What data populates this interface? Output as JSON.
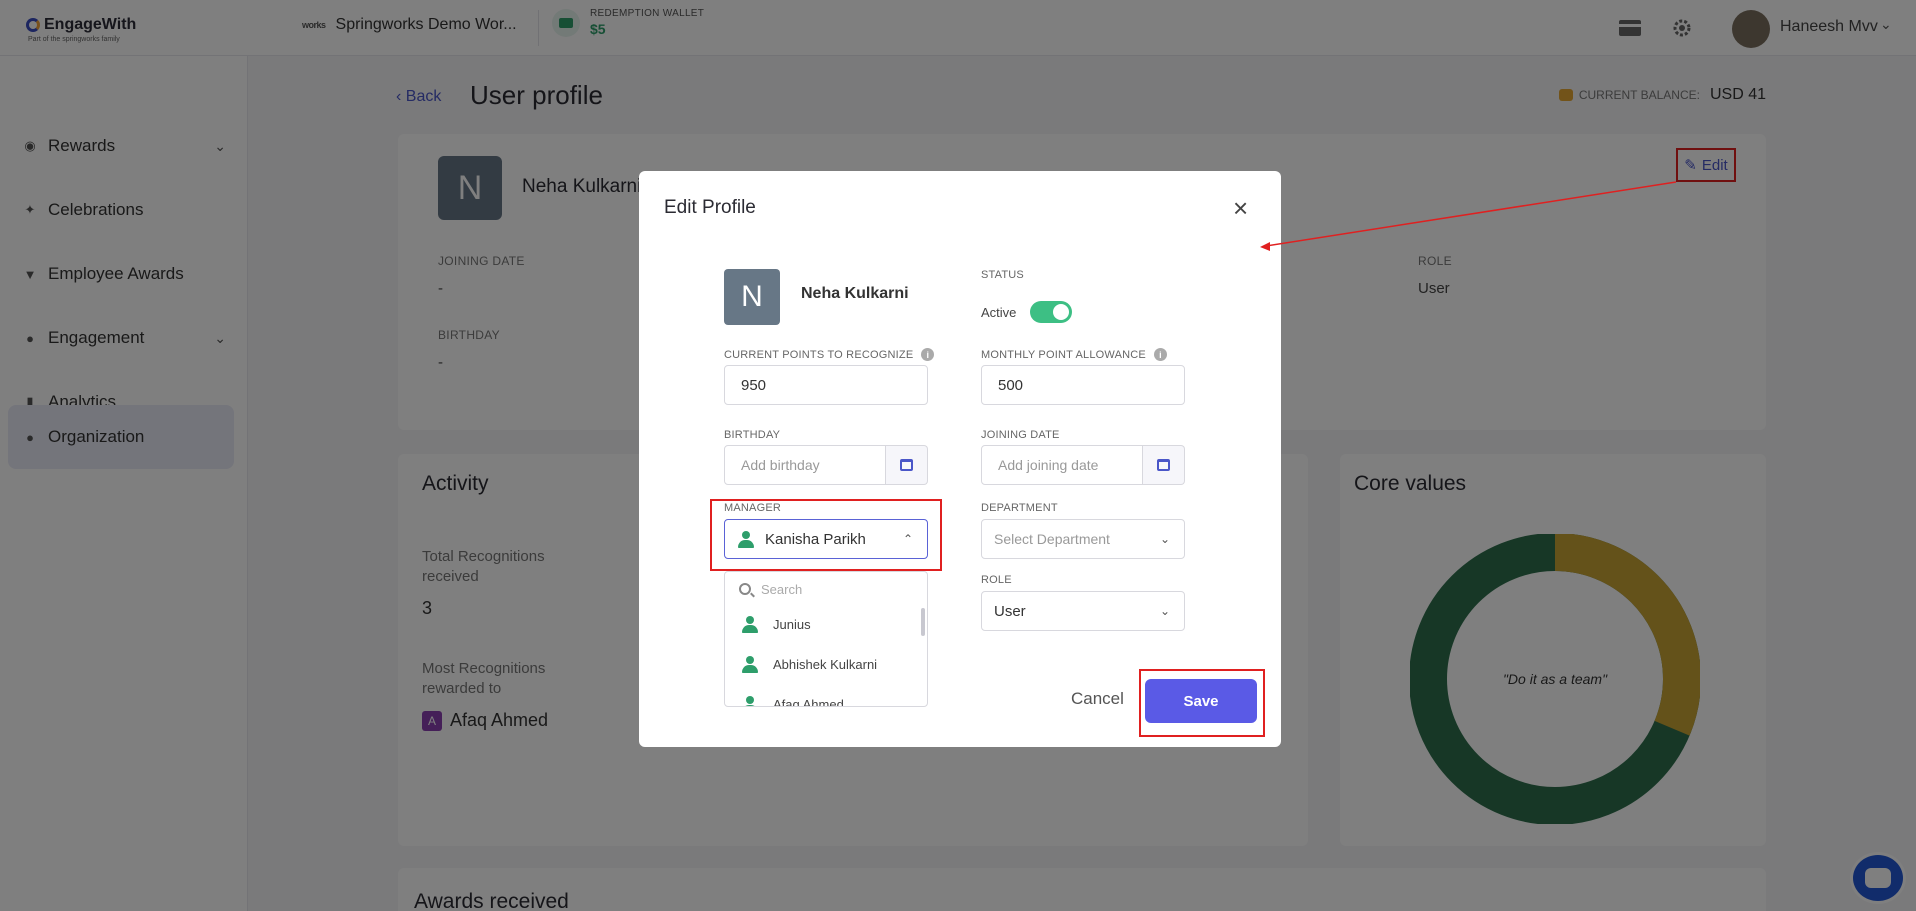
{
  "brand": {
    "name": "EngageWith",
    "tagline": "Part of the springworks family"
  },
  "workspace": {
    "logo_text": "works",
    "name": "Springworks Demo Wor..."
  },
  "wallet": {
    "label": "REDEMPTION WALLET",
    "value": "$5"
  },
  "user": {
    "name": "Haneesh Mvv"
  },
  "icons": {
    "card": "credit-card-icon",
    "settings": "gear-icon",
    "chevron": "chevron-down-icon"
  },
  "sidebar": {
    "items": [
      {
        "label": "Rewards",
        "icon": "medal-icon",
        "expandable": true
      },
      {
        "label": "Celebrations",
        "icon": "party-popper-icon",
        "expandable": false
      },
      {
        "label": "Employee Awards",
        "icon": "trophy-icon",
        "expandable": false
      },
      {
        "label": "Engagement",
        "icon": "people-icon",
        "expandable": true
      },
      {
        "label": "Analytics",
        "icon": "bar-chart-icon",
        "expandable": false
      },
      {
        "label": "Organization",
        "icon": "team-icon",
        "expandable": false,
        "active": true
      }
    ]
  },
  "page": {
    "back": "Back",
    "title": "User profile",
    "balance_label": "CURRENT BALANCE:",
    "balance_value": "USD 41"
  },
  "profile": {
    "initial": "N",
    "name": "Neha Kulkarni",
    "edit": "Edit",
    "joining_date_label": "JOINING DATE",
    "joining_date_value": "-",
    "birthday_label": "BIRTHDAY",
    "birthday_value": "-",
    "role_label": "ROLE",
    "role_value": "User"
  },
  "activity": {
    "title": "Activity",
    "total_label_1": "Total Recognitions",
    "total_label_2": "received",
    "total_value": "3",
    "most_label_1": "Most Recognitions",
    "most_label_2": "rewarded to",
    "most_initial": "A",
    "most_name": "Afaq Ahmed"
  },
  "core_values": {
    "title": "Core values",
    "center_text": "\"Do it as a team\"",
    "colors": {
      "green": "#2f6e4d",
      "gold": "#c9a434"
    }
  },
  "awards": {
    "title": "Awards received"
  },
  "modal": {
    "title": "Edit Profile",
    "close": "×",
    "initial": "N",
    "name": "Neha Kulkarni",
    "status_label": "STATUS",
    "status_value": "Active",
    "status_on": true,
    "points_label": "CURRENT POINTS TO RECOGNIZE",
    "points_value": "950",
    "allowance_label": "MONTHLY POINT ALLOWANCE",
    "allowance_value": "500",
    "birthday_label": "BIRTHDAY",
    "birthday_placeholder": "Add birthday",
    "joining_label": "JOINING DATE",
    "joining_placeholder": "Add joining date",
    "manager_label": "MANAGER",
    "manager_value": "Kanisha Parikh",
    "department_label": "DEPARTMENT",
    "department_placeholder": "Select Department",
    "role_label": "ROLE",
    "role_value": "User",
    "dropdown": {
      "search_placeholder": "Search",
      "options": [
        "Junius",
        "Abhishek Kulkarni",
        "Afaq Ahmed"
      ]
    },
    "cancel": "Cancel",
    "save": "Save"
  },
  "accent_color": "#5a5ae6",
  "annotation_color": "#e02020"
}
